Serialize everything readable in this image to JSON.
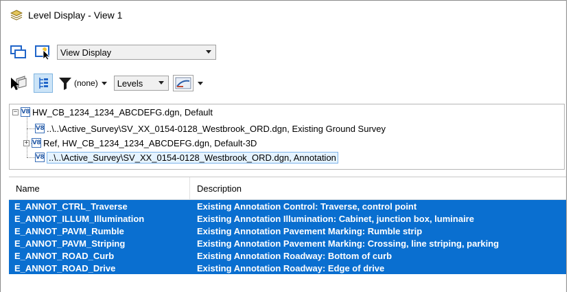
{
  "window": {
    "title": "Level Display - View 1"
  },
  "toolbar1": {
    "view_display_select": "View Display"
  },
  "toolbar2": {
    "filter_value": "(none)",
    "levels_select": "Levels"
  },
  "tree": {
    "nodes": [
      {
        "label": "HW_CB_1234_1234_ABCDEFG.dgn, Default",
        "expander": "−"
      },
      {
        "label": "..\\..\\Active_Survey\\SV_XX_0154-0128_Westbrook_ORD.dgn, Existing Ground Survey"
      },
      {
        "label": "Ref, HW_CB_1234_1234_ABCDEFG.dgn, Default-3D",
        "expander": "+"
      },
      {
        "label": "..\\..\\Active_Survey\\SV_XX_0154-0128_Westbrook_ORD.dgn, Annotation"
      }
    ],
    "model_icon_text": "V8"
  },
  "levels": {
    "columns": [
      "Name",
      "Description"
    ],
    "rows": [
      {
        "name": "E_ANNOT_CTRL_Traverse",
        "description": "Existing Annotation Control:  Traverse, control point"
      },
      {
        "name": "E_ANNOT_ILLUM_Illumination",
        "description": "Existing Annotation Illumination:  Cabinet, junction box, luminaire"
      },
      {
        "name": "E_ANNOT_PAVM_Rumble",
        "description": "Existing Annotation Pavement Marking:  Rumble strip"
      },
      {
        "name": "E_ANNOT_PAVM_Striping",
        "description": "Existing Annotation Pavement Marking:  Crossing, line striping, parking"
      },
      {
        "name": "E_ANNOT_ROAD_Curb",
        "description": "Existing Annotation Roadway:  Bottom of curb"
      },
      {
        "name": "E_ANNOT_ROAD_Drive",
        "description": "Existing Annotation Roadway:  Edge of drive"
      }
    ]
  },
  "colors": {
    "selection": "#0a6fd0",
    "accent": "#2b5ea8"
  }
}
